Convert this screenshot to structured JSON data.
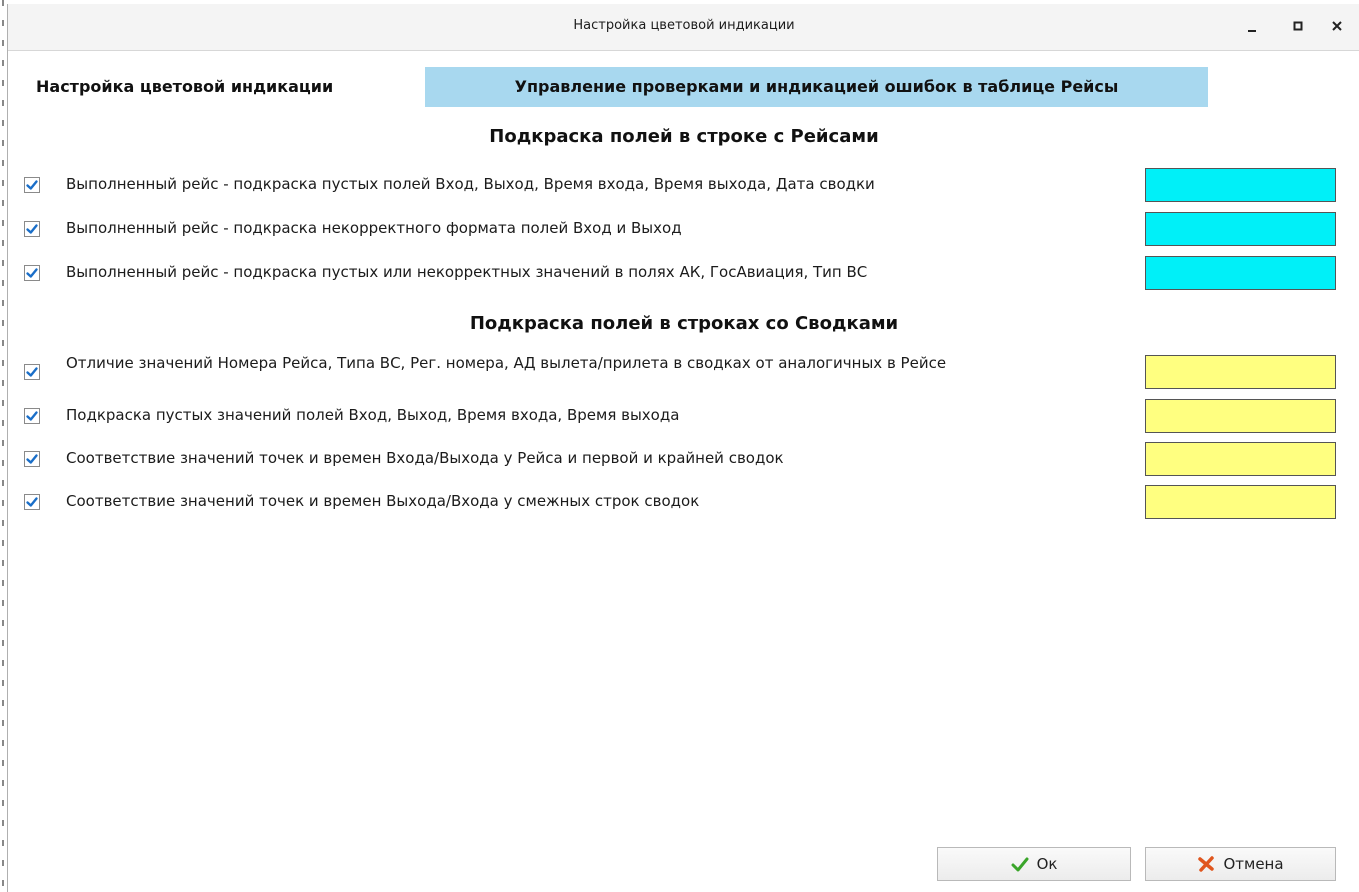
{
  "window": {
    "title": "Настройка цветовой индикации"
  },
  "tabs": [
    {
      "label": "Настройка цветовой индикации"
    },
    {
      "label": "Управление проверками и индикацией ошибок в таблице Рейсы"
    }
  ],
  "sections": [
    {
      "title": "Подкраска полей в строке с Рейсами",
      "items": [
        {
          "label": "Выполненный рейс - подкраска пустых полей Вход, Выход, Время входа, Время выхода, Дата сводки",
          "checked": true,
          "color": "#00f0f8"
        },
        {
          "label": "Выполненный рейс - подкраска некорректного формата полей Вход и Выход",
          "checked": true,
          "color": "#00f0f8"
        },
        {
          "label": "Выполненный рейс - подкраска пустых или некорректных значений в полях АК, ГосАвиация, Тип ВС",
          "checked": true,
          "color": "#00f0f8"
        }
      ]
    },
    {
      "title": "Подкраска полей в строках со Сводками",
      "items": [
        {
          "label": "Отличие значений Номера Рейса, Типа ВС, Рег. номера, АД вылета/прилета в сводках от аналогичных в Рейсе",
          "checked": true,
          "color": "#ffff80"
        },
        {
          "label": "Подкраска пустых значений полей Вход, Выход, Время входа, Время выхода",
          "checked": true,
          "color": "#ffff80"
        },
        {
          "label": "Соответствие значений точек и времен Входа/Выхода у Рейса и первой и крайней сводок",
          "checked": true,
          "color": "#ffff80"
        },
        {
          "label": "Соответствие значений точек и времен Выхода/Входа у смежных строк сводок",
          "checked": true,
          "color": "#ffff80"
        }
      ]
    }
  ],
  "buttons": {
    "ok": "Ок",
    "cancel": "Отмена"
  },
  "icons": {
    "ok": "checkmark-icon",
    "cancel": "cross-icon"
  },
  "colors": {
    "active_tab": "#a8d8ef",
    "checkbox_mark": "#1a6ec8",
    "ok_icon": "#3aa52a",
    "cancel_icon": "#e0561e"
  }
}
